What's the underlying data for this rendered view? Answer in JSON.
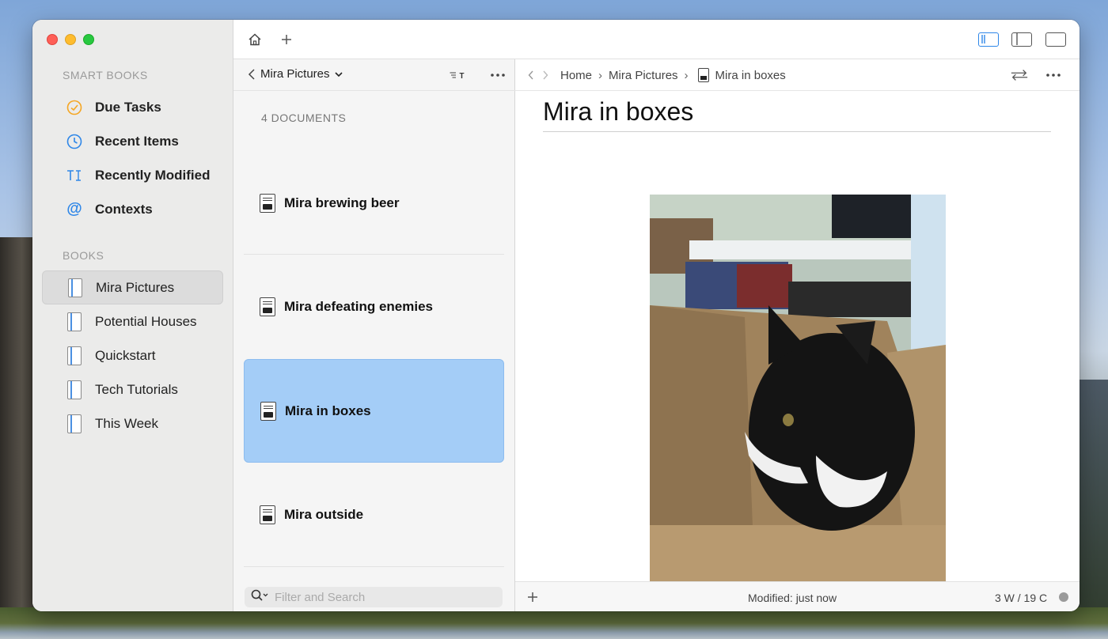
{
  "sidebar": {
    "smart_books_title": "SMART BOOKS",
    "smart_items": [
      {
        "label": "Due Tasks",
        "icon": "check-circle-icon",
        "color": "#f5a623"
      },
      {
        "label": "Recent Items",
        "icon": "clock-icon",
        "color": "#2f87e8"
      },
      {
        "label": "Recently Modified",
        "icon": "text-cursor-icon",
        "color": "#2f87e8"
      },
      {
        "label": "Contexts",
        "icon": "at-icon",
        "color": "#2f87e8"
      }
    ],
    "books_title": "BOOKS",
    "books": [
      {
        "label": "Mira Pictures",
        "selected": true
      },
      {
        "label": "Potential Houses"
      },
      {
        "label": "Quickstart"
      },
      {
        "label": "Tech Tutorials"
      },
      {
        "label": "This Week"
      }
    ]
  },
  "doclist": {
    "title": "Mira Pictures",
    "count_label": "4 DOCUMENTS",
    "documents": [
      {
        "label": "Mira brewing beer"
      },
      {
        "label": "Mira defeating enemies"
      },
      {
        "label": "Mira in boxes",
        "selected": true
      },
      {
        "label": "Mira outside"
      }
    ],
    "search_placeholder": "Filter and Search"
  },
  "editor": {
    "breadcrumb": [
      "Home",
      "Mira Pictures",
      "Mira in boxes"
    ],
    "title": "Mira in boxes",
    "modified": "Modified: just now",
    "word_count": "3 W / 19 C"
  },
  "colors": {
    "accent": "#2f87e8",
    "selection": "#a4cdf7"
  }
}
